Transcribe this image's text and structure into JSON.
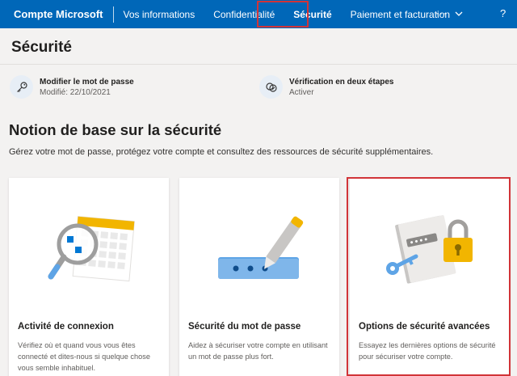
{
  "nav": {
    "brand": "Compte Microsoft",
    "items": [
      {
        "label": "Vos informations"
      },
      {
        "label": "Confidentialité"
      },
      {
        "label": "Sécurité"
      },
      {
        "label": "Paiement et facturation"
      }
    ],
    "more": "···",
    "help": "?"
  },
  "page": {
    "title": "Sécurité"
  },
  "quick_actions": [
    {
      "title": "Modifier le mot de passe",
      "subtitle": "Modifié: 22/10/2021",
      "icon": "key-icon"
    },
    {
      "title": "Vérification en deux étapes",
      "subtitle": "Activer",
      "icon": "two-step-icon"
    }
  ],
  "section": {
    "title": "Notion de base sur la sécurité",
    "description": "Gérez votre mot de passe, protégez votre compte et consultez des ressources de sécurité supplémentaires."
  },
  "cards": [
    {
      "title": "Activité de connexion",
      "description": "Vérifiez où et quand vous vous êtes connecté et dites-nous si quelque chose vous semble inhabituel."
    },
    {
      "title": "Sécurité du mot de passe",
      "description": "Aidez à sécuriser votre compte en utilisant un mot de passe plus fort."
    },
    {
      "title": "Options de sécurité avancées",
      "description": "Essayez les dernières options de sécurité pour sécuriser votre compte."
    }
  ],
  "colors": {
    "accent": "#0067b8",
    "highlight": "#d13438",
    "gold": "#f2b500",
    "background": "#f3f2f1"
  }
}
